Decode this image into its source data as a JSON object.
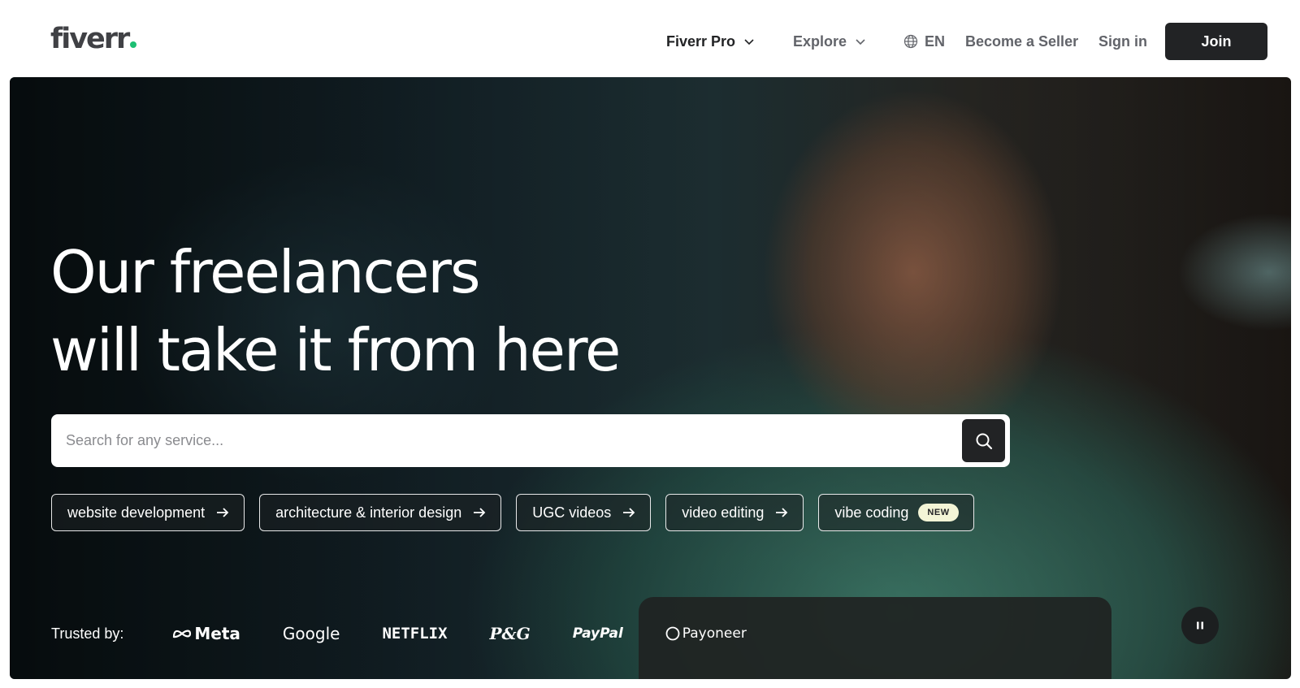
{
  "header": {
    "logo_text": "fiverr",
    "nav": {
      "fiverr_pro": "Fiverr Pro",
      "explore": "Explore",
      "language": "EN",
      "become_seller": "Become a Seller",
      "sign_in": "Sign in",
      "join": "Join"
    }
  },
  "hero": {
    "headline_line1": "Our freelancers",
    "headline_line2": "will take it from here",
    "search": {
      "placeholder": "Search for any service...",
      "value": ""
    },
    "chips": [
      {
        "label": "website development"
      },
      {
        "label": "architecture & interior design"
      },
      {
        "label": "UGC videos"
      },
      {
        "label": "video editing"
      },
      {
        "label": "vibe coding",
        "badge": "NEW"
      }
    ],
    "trusted_by": {
      "label": "Trusted by:",
      "brands": [
        "Meta",
        "Google",
        "NETFLIX",
        "P&G",
        "PayPal",
        "Payoneer"
      ]
    }
  },
  "colors": {
    "brand_green": "#1dbf73",
    "dark": "#222325",
    "badge_bg": "#f3f5d6"
  },
  "icons": {
    "nav_chevron": "chevron-down-icon",
    "language": "globe-icon",
    "search": "search-icon",
    "chip_arrow": "arrow-right-icon",
    "video_control": "pause-icon"
  }
}
